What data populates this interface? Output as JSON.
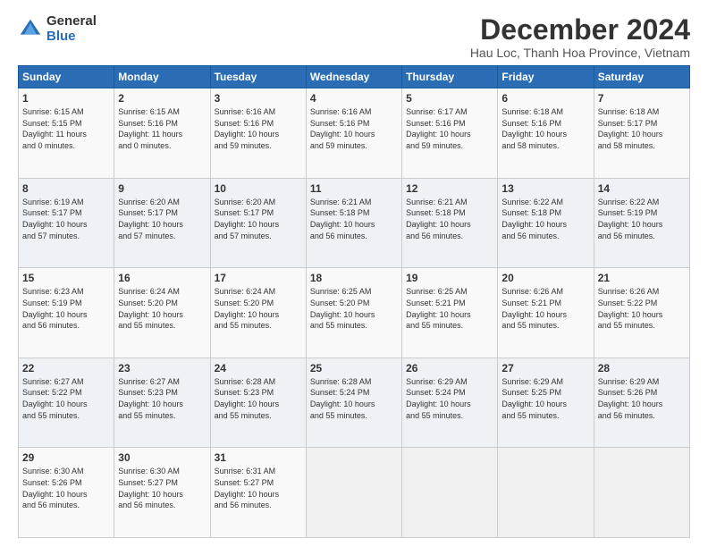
{
  "logo": {
    "general": "General",
    "blue": "Blue"
  },
  "title": "December 2024",
  "subtitle": "Hau Loc, Thanh Hoa Province, Vietnam",
  "days_of_week": [
    "Sunday",
    "Monday",
    "Tuesday",
    "Wednesday",
    "Thursday",
    "Friday",
    "Saturday"
  ],
  "weeks": [
    [
      {
        "day": "1",
        "info": "Sunrise: 6:15 AM\nSunset: 5:15 PM\nDaylight: 11 hours\nand 0 minutes."
      },
      {
        "day": "2",
        "info": "Sunrise: 6:15 AM\nSunset: 5:16 PM\nDaylight: 11 hours\nand 0 minutes."
      },
      {
        "day": "3",
        "info": "Sunrise: 6:16 AM\nSunset: 5:16 PM\nDaylight: 10 hours\nand 59 minutes."
      },
      {
        "day": "4",
        "info": "Sunrise: 6:16 AM\nSunset: 5:16 PM\nDaylight: 10 hours\nand 59 minutes."
      },
      {
        "day": "5",
        "info": "Sunrise: 6:17 AM\nSunset: 5:16 PM\nDaylight: 10 hours\nand 59 minutes."
      },
      {
        "day": "6",
        "info": "Sunrise: 6:18 AM\nSunset: 5:16 PM\nDaylight: 10 hours\nand 58 minutes."
      },
      {
        "day": "7",
        "info": "Sunrise: 6:18 AM\nSunset: 5:17 PM\nDaylight: 10 hours\nand 58 minutes."
      }
    ],
    [
      {
        "day": "8",
        "info": "Sunrise: 6:19 AM\nSunset: 5:17 PM\nDaylight: 10 hours\nand 57 minutes."
      },
      {
        "day": "9",
        "info": "Sunrise: 6:20 AM\nSunset: 5:17 PM\nDaylight: 10 hours\nand 57 minutes."
      },
      {
        "day": "10",
        "info": "Sunrise: 6:20 AM\nSunset: 5:17 PM\nDaylight: 10 hours\nand 57 minutes."
      },
      {
        "day": "11",
        "info": "Sunrise: 6:21 AM\nSunset: 5:18 PM\nDaylight: 10 hours\nand 56 minutes."
      },
      {
        "day": "12",
        "info": "Sunrise: 6:21 AM\nSunset: 5:18 PM\nDaylight: 10 hours\nand 56 minutes."
      },
      {
        "day": "13",
        "info": "Sunrise: 6:22 AM\nSunset: 5:18 PM\nDaylight: 10 hours\nand 56 minutes."
      },
      {
        "day": "14",
        "info": "Sunrise: 6:22 AM\nSunset: 5:19 PM\nDaylight: 10 hours\nand 56 minutes."
      }
    ],
    [
      {
        "day": "15",
        "info": "Sunrise: 6:23 AM\nSunset: 5:19 PM\nDaylight: 10 hours\nand 56 minutes."
      },
      {
        "day": "16",
        "info": "Sunrise: 6:24 AM\nSunset: 5:20 PM\nDaylight: 10 hours\nand 55 minutes."
      },
      {
        "day": "17",
        "info": "Sunrise: 6:24 AM\nSunset: 5:20 PM\nDaylight: 10 hours\nand 55 minutes."
      },
      {
        "day": "18",
        "info": "Sunrise: 6:25 AM\nSunset: 5:20 PM\nDaylight: 10 hours\nand 55 minutes."
      },
      {
        "day": "19",
        "info": "Sunrise: 6:25 AM\nSunset: 5:21 PM\nDaylight: 10 hours\nand 55 minutes."
      },
      {
        "day": "20",
        "info": "Sunrise: 6:26 AM\nSunset: 5:21 PM\nDaylight: 10 hours\nand 55 minutes."
      },
      {
        "day": "21",
        "info": "Sunrise: 6:26 AM\nSunset: 5:22 PM\nDaylight: 10 hours\nand 55 minutes."
      }
    ],
    [
      {
        "day": "22",
        "info": "Sunrise: 6:27 AM\nSunset: 5:22 PM\nDaylight: 10 hours\nand 55 minutes."
      },
      {
        "day": "23",
        "info": "Sunrise: 6:27 AM\nSunset: 5:23 PM\nDaylight: 10 hours\nand 55 minutes."
      },
      {
        "day": "24",
        "info": "Sunrise: 6:28 AM\nSunset: 5:23 PM\nDaylight: 10 hours\nand 55 minutes."
      },
      {
        "day": "25",
        "info": "Sunrise: 6:28 AM\nSunset: 5:24 PM\nDaylight: 10 hours\nand 55 minutes."
      },
      {
        "day": "26",
        "info": "Sunrise: 6:29 AM\nSunset: 5:24 PM\nDaylight: 10 hours\nand 55 minutes."
      },
      {
        "day": "27",
        "info": "Sunrise: 6:29 AM\nSunset: 5:25 PM\nDaylight: 10 hours\nand 55 minutes."
      },
      {
        "day": "28",
        "info": "Sunrise: 6:29 AM\nSunset: 5:26 PM\nDaylight: 10 hours\nand 56 minutes."
      }
    ],
    [
      {
        "day": "29",
        "info": "Sunrise: 6:30 AM\nSunset: 5:26 PM\nDaylight: 10 hours\nand 56 minutes."
      },
      {
        "day": "30",
        "info": "Sunrise: 6:30 AM\nSunset: 5:27 PM\nDaylight: 10 hours\nand 56 minutes."
      },
      {
        "day": "31",
        "info": "Sunrise: 6:31 AM\nSunset: 5:27 PM\nDaylight: 10 hours\nand 56 minutes."
      },
      null,
      null,
      null,
      null
    ]
  ]
}
